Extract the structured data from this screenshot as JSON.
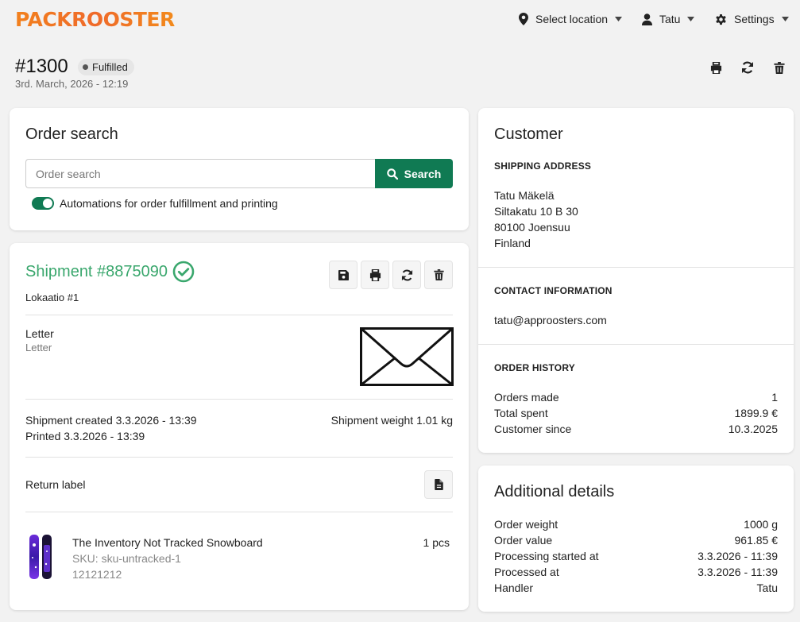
{
  "header": {
    "logo": "PACKROOSTER",
    "location_label": "Select location",
    "user_label": "Tatu",
    "settings_label": "Settings"
  },
  "order": {
    "number": "#1300",
    "status": "Fulfilled",
    "date": "3rd. March, 2026 - 12:19"
  },
  "search": {
    "title": "Order search",
    "placeholder": "Order search",
    "button_label": "Search",
    "toggle_label": "Automations for order fulfillment and printing",
    "toggle_on": true
  },
  "shipment": {
    "title": "Shipment #8875090",
    "location": "Lokaatio #1",
    "package_type": "Letter",
    "package_subtype": "Letter",
    "created": "Shipment created 3.3.2026 - 13:39",
    "printed": "Printed 3.3.2026 - 13:39",
    "weight": "Shipment weight 1.01 kg",
    "return_label": "Return label",
    "item": {
      "name": "The Inventory Not Tracked Snowboard",
      "sku": "SKU: sku-untracked-1",
      "code": "12121212",
      "qty": "1 pcs"
    }
  },
  "customer": {
    "title": "Customer",
    "shipping_heading": "SHIPPING ADDRESS",
    "address": [
      "Tatu Mäkelä",
      "Siltakatu 10 B 30",
      "80100 Joensuu",
      "Finland"
    ],
    "contact_heading": "CONTACT INFORMATION",
    "email": "tatu@approosters.com",
    "history_heading": "ORDER HISTORY",
    "history": [
      {
        "label": "Orders made",
        "value": "1"
      },
      {
        "label": "Total spent",
        "value": "1899.9 €"
      },
      {
        "label": "Customer since",
        "value": "10.3.2025"
      }
    ]
  },
  "additional": {
    "title": "Additional details",
    "rows": [
      {
        "label": "Order weight",
        "value": "1000 g"
      },
      {
        "label": "Order value",
        "value": "961.85 €"
      },
      {
        "label": "Processing started at",
        "value": "3.3.2026 - 11:39"
      },
      {
        "label": "Processed at",
        "value": "3.3.2026 - 11:39"
      },
      {
        "label": "Handler",
        "value": "Tatu"
      }
    ]
  },
  "colors": {
    "brand_orange": "#f2811d",
    "primary_green": "#107a53",
    "success_green": "#3aa76d"
  }
}
